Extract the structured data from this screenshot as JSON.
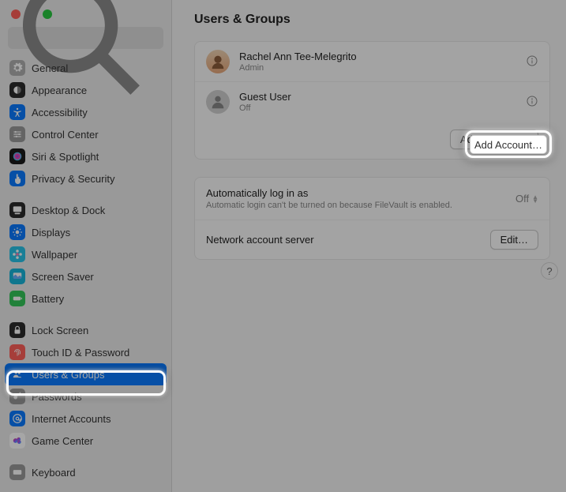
{
  "window": {
    "search_placeholder": "Search"
  },
  "sidebar": {
    "groups": [
      [
        {
          "key": "general",
          "label": "General",
          "icon": "gear",
          "bg": "#b0b0b0"
        },
        {
          "key": "appearance",
          "label": "Appearance",
          "icon": "appearance",
          "bg": "#2c2c2c"
        },
        {
          "key": "accessibility",
          "label": "Accessibility",
          "icon": "accessibility",
          "bg": "#0a7aff"
        },
        {
          "key": "control-center",
          "label": "Control Center",
          "icon": "sliders",
          "bg": "#9a9a9a"
        },
        {
          "key": "siri",
          "label": "Siri & Spotlight",
          "icon": "siri",
          "bg": "#1b1b1b"
        },
        {
          "key": "privacy",
          "label": "Privacy & Security",
          "icon": "hand",
          "bg": "#0a7aff"
        }
      ],
      [
        {
          "key": "desktop-dock",
          "label": "Desktop & Dock",
          "icon": "dock",
          "bg": "#2c2c2c"
        },
        {
          "key": "displays",
          "label": "Displays",
          "icon": "sun",
          "bg": "#0a7aff"
        },
        {
          "key": "wallpaper",
          "label": "Wallpaper",
          "icon": "flower",
          "bg": "#29c3e8"
        },
        {
          "key": "screensaver",
          "label": "Screen Saver",
          "icon": "screensaver",
          "bg": "#18b6da"
        },
        {
          "key": "battery",
          "label": "Battery",
          "icon": "battery",
          "bg": "#34c759"
        }
      ],
      [
        {
          "key": "lock-screen",
          "label": "Lock Screen",
          "icon": "lock",
          "bg": "#2c2c2c"
        },
        {
          "key": "touchid",
          "label": "Touch ID & Password",
          "icon": "fingerprint",
          "bg": "#ff6059"
        },
        {
          "key": "users-groups",
          "label": "Users & Groups",
          "icon": "users",
          "bg": "#0a7aff",
          "selected": true
        },
        {
          "key": "passwords",
          "label": "Passwords",
          "icon": "key",
          "bg": "#9a9a9a"
        },
        {
          "key": "internet-accounts",
          "label": "Internet Accounts",
          "icon": "at",
          "bg": "#0a7aff"
        },
        {
          "key": "game-center",
          "label": "Game Center",
          "icon": "game",
          "bg": "#ffffff"
        }
      ],
      [
        {
          "key": "keyboard",
          "label": "Keyboard",
          "icon": "keyboard",
          "bg": "#9a9a9a"
        }
      ]
    ]
  },
  "page": {
    "title": "Users & Groups"
  },
  "users": [
    {
      "name": "Rachel Ann Tee-Melegrito",
      "role": "Admin",
      "avatar": "admin"
    },
    {
      "name": "Guest User",
      "role": "Off",
      "avatar": "guest"
    }
  ],
  "add_account_label": "Add Account…",
  "auto_login": {
    "title": "Automatically log in as",
    "value": "Off",
    "note": "Automatic login can't be turned on because FileVault is enabled."
  },
  "network_server": {
    "title": "Network account server",
    "button": "Edit…"
  },
  "help_label": "?"
}
